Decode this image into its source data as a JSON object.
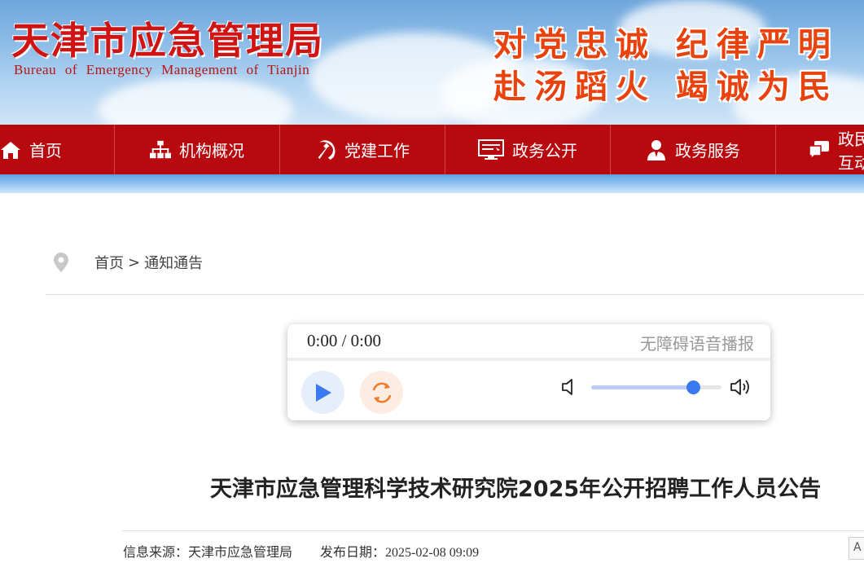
{
  "header": {
    "site_title": "天津市应急管理局",
    "site_subtitle": "Bureau  of  Emergency  Management  of  Tianjin",
    "slogan_line1": "对党忠诚  纪律严明",
    "slogan_line2": "赴汤蹈火  竭诚为民"
  },
  "nav": {
    "items": [
      {
        "label": "首页",
        "icon": "home-icon"
      },
      {
        "label": "机构概况",
        "icon": "org-chart-icon"
      },
      {
        "label": "党建工作",
        "icon": "party-emblem-icon"
      },
      {
        "label": "政务公开",
        "icon": "monitor-icon"
      },
      {
        "label": "政务服务",
        "icon": "user-service-icon"
      },
      {
        "label": "政民互动",
        "icon": "chat-icon"
      }
    ]
  },
  "breadcrumb": {
    "home": "首页",
    "separator": ">",
    "current": "通知通告"
  },
  "player": {
    "time": "0:00 / 0:00",
    "accessibility_label": "无障碍语音播报",
    "volume": 0.78,
    "accent_color": "#3a79f0"
  },
  "article": {
    "title": "天津市应急管理科学技术研究院2025年公开招聘工作人员公告",
    "source_label": "信息来源：",
    "source_value": "天津市应急管理局",
    "date_label": "发布日期：",
    "date_value": "2025-02-08 09:09",
    "font_size_button": "A"
  },
  "colors": {
    "nav_red": "#b8090f",
    "title_red": "#d01414",
    "slogan_orange": "#e8430f"
  }
}
